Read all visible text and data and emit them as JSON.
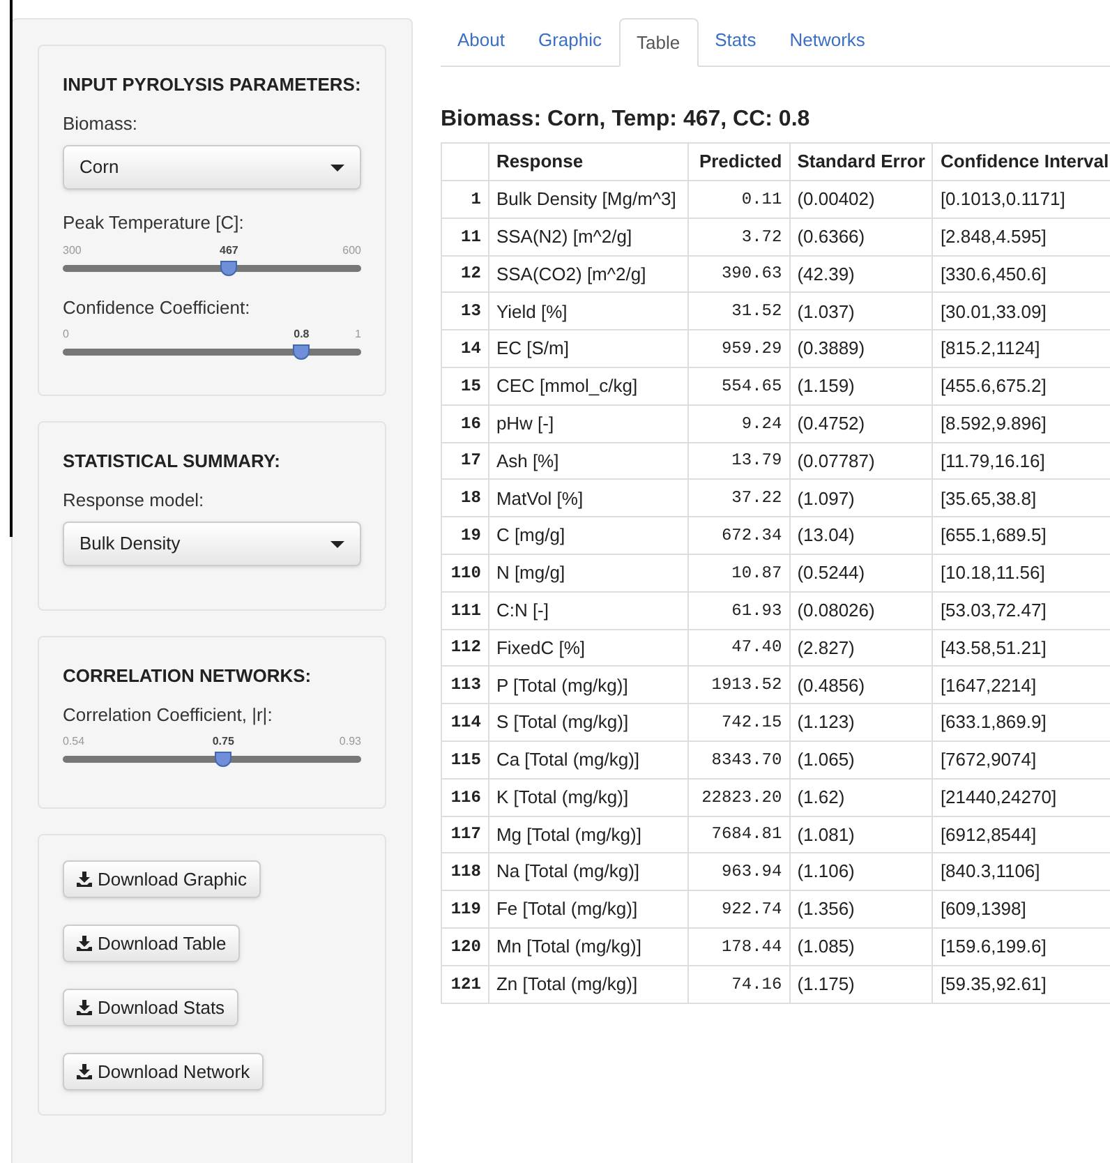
{
  "sidebar": {
    "sections": [
      {
        "title": "INPUT PYROLYSIS PARAMETERS:",
        "controls": [
          {
            "kind": "select",
            "label": "Biomass:",
            "value": "Corn"
          },
          {
            "kind": "slider",
            "label": "Peak Temperature [C]:",
            "min": "300",
            "max": "600",
            "reading": "467",
            "level": 0.557
          },
          {
            "kind": "slider",
            "label": "Confidence Coefficient:",
            "min": "0",
            "max": "1",
            "reading": "0.8",
            "level": 0.8
          }
        ]
      },
      {
        "title": "STATISTICAL SUMMARY:",
        "controls": [
          {
            "kind": "select",
            "label": "Response model:",
            "value": "Bulk Density"
          }
        ]
      },
      {
        "title": "CORRELATION NETWORKS:",
        "controls": [
          {
            "kind": "slider",
            "label": "Correlation Coefficient, |r|:",
            "min": "0.54",
            "max": "0.93",
            "reading": "0.75",
            "level": 0.538
          }
        ]
      },
      {
        "controls": [
          {
            "kind": "button",
            "label": "Download Graphic"
          },
          {
            "kind": "button",
            "label": "Download Table"
          },
          {
            "kind": "button",
            "label": "Download Stats"
          },
          {
            "kind": "button",
            "label": "Download Network"
          }
        ]
      }
    ]
  },
  "tabs": [
    {
      "label": "About",
      "selected": false
    },
    {
      "label": "Graphic",
      "selected": false
    },
    {
      "label": "Table",
      "selected": true
    },
    {
      "label": "Stats",
      "selected": false
    },
    {
      "label": "Networks",
      "selected": false
    }
  ],
  "heading": "Biomass: Corn, Temp: 467, CC: 0.8",
  "table": {
    "columns": [
      "",
      "Response",
      "Predicted",
      "Standard Error",
      "Confidence Interval"
    ],
    "rows": [
      [
        "1",
        "Bulk Density [Mg/m^3]",
        "0.11",
        "(0.00402)",
        "[0.1013,0.1171]"
      ],
      [
        "11",
        "SSA(N2) [m^2/g]",
        "3.72",
        "(0.6366)",
        "[2.848,4.595]"
      ],
      [
        "12",
        "SSA(CO2) [m^2/g]",
        "390.63",
        "(42.39)",
        "[330.6,450.6]"
      ],
      [
        "13",
        "Yield [%]",
        "31.52",
        "(1.037)",
        "[30.01,33.09]"
      ],
      [
        "14",
        "EC [S/m]",
        "959.29",
        "(0.3889)",
        "[815.2,1124]"
      ],
      [
        "15",
        "CEC [mmol_c/kg]",
        "554.65",
        "(1.159)",
        "[455.6,675.2]"
      ],
      [
        "16",
        "pHw [-]",
        "9.24",
        "(0.4752)",
        "[8.592,9.896]"
      ],
      [
        "17",
        "Ash [%]",
        "13.79",
        "(0.07787)",
        "[11.79,16.16]"
      ],
      [
        "18",
        "MatVol [%]",
        "37.22",
        "(1.097)",
        "[35.65,38.8]"
      ],
      [
        "19",
        "C [mg/g]",
        "672.34",
        "(13.04)",
        "[655.1,689.5]"
      ],
      [
        "110",
        "N [mg/g]",
        "10.87",
        "(0.5244)",
        "[10.18,11.56]"
      ],
      [
        "111",
        "C:N [-]",
        "61.93",
        "(0.08026)",
        "[53.03,72.47]"
      ],
      [
        "112",
        "FixedC [%]",
        "47.40",
        "(2.827)",
        "[43.58,51.21]"
      ],
      [
        "113",
        "P [Total (mg/kg)]",
        "1913.52",
        "(0.4856)",
        "[1647,2214]"
      ],
      [
        "114",
        "S [Total (mg/kg)]",
        "742.15",
        "(1.123)",
        "[633.1,869.9]"
      ],
      [
        "115",
        "Ca [Total (mg/kg)]",
        "8343.70",
        "(1.065)",
        "[7672,9074]"
      ],
      [
        "116",
        "K [Total (mg/kg)]",
        "22823.20",
        "(1.62)",
        "[21440,24270]"
      ],
      [
        "117",
        "Mg [Total (mg/kg)]",
        "7684.81",
        "(1.081)",
        "[6912,8544]"
      ],
      [
        "118",
        "Na [Total (mg/kg)]",
        "963.94",
        "(1.106)",
        "[840.3,1106]"
      ],
      [
        "119",
        "Fe [Total (mg/kg)]",
        "922.74",
        "(1.356)",
        "[609,1398]"
      ],
      [
        "120",
        "Mn [Total (mg/kg)]",
        "178.44",
        "(1.085)",
        "[159.6,199.6]"
      ],
      [
        "121",
        "Zn [Total (mg/kg)]",
        "74.16",
        "(1.175)",
        "[59.35,92.61]"
      ]
    ]
  }
}
